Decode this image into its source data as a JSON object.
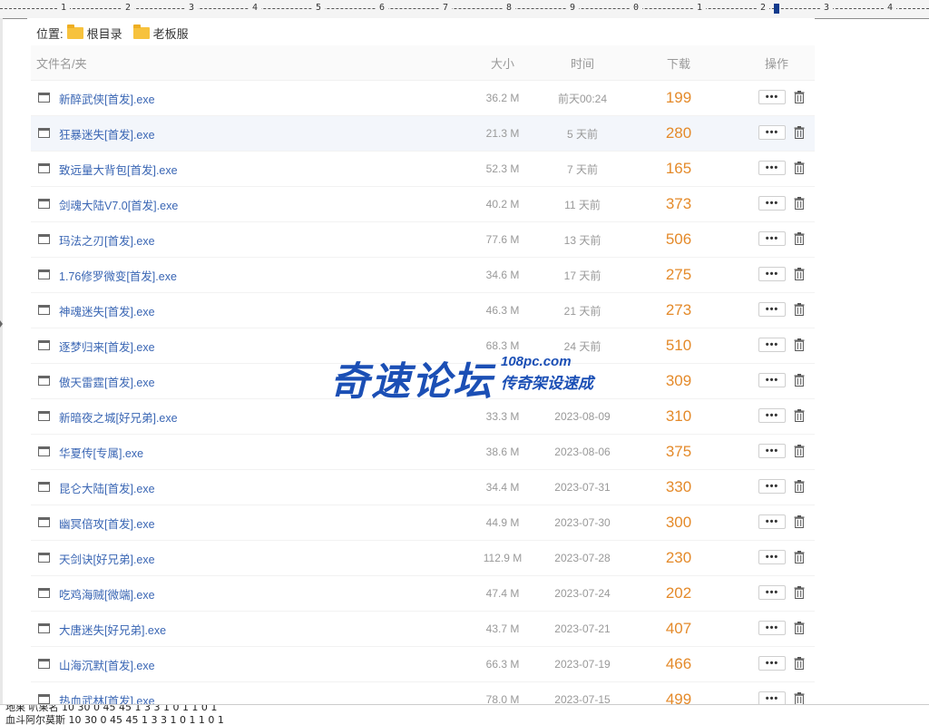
{
  "ruler": {
    "ticks": [
      "1",
      "2",
      "3",
      "4",
      "5",
      "6",
      "7",
      "8",
      "9",
      "0",
      "1",
      "2",
      "3",
      "4"
    ]
  },
  "breadcrumb": {
    "label": "位置:",
    "items": [
      "根目录",
      "老板服"
    ]
  },
  "table": {
    "headers": {
      "name": "文件名/夹",
      "size": "大小",
      "time": "时间",
      "downloads": "下载",
      "actions": "操作"
    },
    "more_label": "•••",
    "rows": [
      {
        "name": "新醉武侠[首发].exe",
        "size": "36.2 M",
        "time": "前天00:24",
        "downloads": "199"
      },
      {
        "name": "狂暴迷失[首发].exe",
        "size": "21.3 M",
        "time": "5 天前",
        "downloads": "280"
      },
      {
        "name": "致远量大背包[首发].exe",
        "size": "52.3 M",
        "time": "7 天前",
        "downloads": "165"
      },
      {
        "name": "剑魂大陆V7.0[首发].exe",
        "size": "40.2 M",
        "time": "11 天前",
        "downloads": "373"
      },
      {
        "name": "玛法之刃[首发].exe",
        "size": "77.6 M",
        "time": "13 天前",
        "downloads": "506"
      },
      {
        "name": "1.76修罗微变[首发].exe",
        "size": "34.6 M",
        "time": "17 天前",
        "downloads": "275"
      },
      {
        "name": "神魂迷失[首发].exe",
        "size": "46.3 M",
        "time": "21 天前",
        "downloads": "273"
      },
      {
        "name": "逐梦归来[首发].exe",
        "size": "68.3 M",
        "time": "24 天前",
        "downloads": "510"
      },
      {
        "name": "傲天雷霆[首发].exe",
        "size": "",
        "time": "",
        "downloads": "309"
      },
      {
        "name": "新暗夜之城[好兄弟].exe",
        "size": "33.3 M",
        "time": "2023-08-09",
        "downloads": "310"
      },
      {
        "name": "华夏传[专属].exe",
        "size": "38.6 M",
        "time": "2023-08-06",
        "downloads": "375"
      },
      {
        "name": "昆仑大陆[首发].exe",
        "size": "34.4 M",
        "time": "2023-07-31",
        "downloads": "330"
      },
      {
        "name": "幽冥倍攻[首发].exe",
        "size": "44.9 M",
        "time": "2023-07-30",
        "downloads": "300"
      },
      {
        "name": "天剑诀[好兄弟].exe",
        "size": "112.9 M",
        "time": "2023-07-28",
        "downloads": "230"
      },
      {
        "name": "吃鸡海贼[微端].exe",
        "size": "47.4 M",
        "time": "2023-07-24",
        "downloads": "202"
      },
      {
        "name": "大唐迷失[好兄弟].exe",
        "size": "43.7 M",
        "time": "2023-07-21",
        "downloads": "407"
      },
      {
        "name": "山海沉默[首发].exe",
        "size": "66.3 M",
        "time": "2023-07-19",
        "downloads": "466"
      },
      {
        "name": "热血武林[首发].exe",
        "size": "78.0 M",
        "time": "2023-07-15",
        "downloads": "499"
      }
    ]
  },
  "watermark": {
    "main": "奇速论坛",
    "url": "108pc.com",
    "sub": "传奇架设速成"
  },
  "bottom_strip": {
    "line1": "地果    叭果名      10        30        0         45        45        1         3         3         1         0         1         1         0         1",
    "line2": "血斗阿尔莫斯     10        30        0         45        45        1         3         3         1         0         1         1         0         1"
  },
  "colors": {
    "link": "#3a66b4",
    "downloads": "#e48a2a",
    "watermark": "#1b4fb5",
    "folder": "#f7c23d"
  }
}
